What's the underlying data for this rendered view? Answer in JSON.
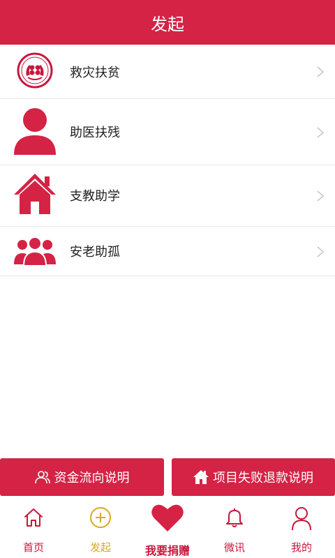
{
  "header": {
    "title": "发起"
  },
  "categories": [
    {
      "label": "救灾扶贫",
      "icon": "charity-emblem-icon"
    },
    {
      "label": "助医扶残",
      "icon": "person-icon"
    },
    {
      "label": "支教助学",
      "icon": "house-icon"
    },
    {
      "label": "安老助孤",
      "icon": "group-icon"
    }
  ],
  "actions": {
    "fund_flow_label": "资金流向说明",
    "refund_label": "项目失败退款说明"
  },
  "tabbar": {
    "home": "首页",
    "launch": "发起",
    "donate": "我要捐赠",
    "news": "微讯",
    "mine": "我的"
  },
  "colors": {
    "brand": "#d42345",
    "active_tab": "#d9a825",
    "divider": "#ececec"
  }
}
